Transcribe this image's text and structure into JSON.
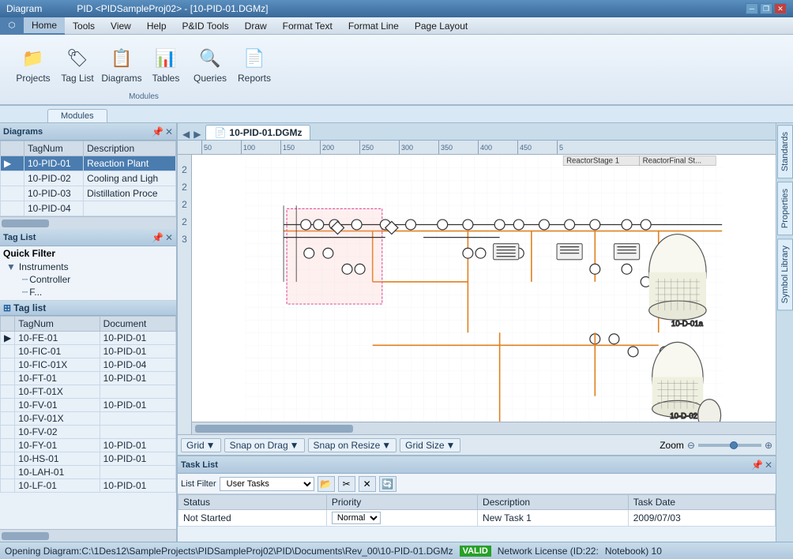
{
  "titleBar": {
    "appTitle": "Diagram",
    "windowTitle": "PID <PIDSampleProj02> - [10-PID-01.DGMz]",
    "minLabel": "─",
    "restoreLabel": "❐",
    "closeLabel": "✕"
  },
  "menuBar": {
    "items": [
      "Home",
      "Tools",
      "View",
      "Help",
      "P&ID Tools",
      "Draw",
      "Format Text",
      "Format Line",
      "Page Layout"
    ]
  },
  "ribbon": {
    "groupLabel": "Modules",
    "buttons": [
      {
        "label": "Projects",
        "icon": "📁"
      },
      {
        "label": "Tag List",
        "icon": "🏷"
      },
      {
        "label": "Diagrams",
        "icon": "📋"
      },
      {
        "label": "Tables",
        "icon": "📊"
      },
      {
        "label": "Queries",
        "icon": "🔍"
      },
      {
        "label": "Reports",
        "icon": "📄"
      }
    ]
  },
  "modulesTab": {
    "label": "Modules"
  },
  "diagrams": {
    "panelTitle": "Diagrams",
    "columns": [
      "TagNum",
      "Description"
    ],
    "rows": [
      {
        "tagNum": "10-PID-01",
        "description": "Reaction Plant",
        "selected": true
      },
      {
        "tagNum": "10-PID-02",
        "description": "Cooling and Ligh"
      },
      {
        "tagNum": "10-PID-03",
        "description": "Distillation Proce"
      },
      {
        "tagNum": "10-PID-04",
        "description": ""
      }
    ]
  },
  "tagList": {
    "panelTitle": "Tag List",
    "quickFilterLabel": "Quick Filter",
    "treeItems": [
      {
        "label": "Instruments",
        "level": 0,
        "expanded": true
      },
      {
        "label": "Controller",
        "level": 1
      }
    ],
    "subPanelLabel": "Tag list",
    "columns": [
      "TagNum",
      "Document"
    ],
    "rows": [
      {
        "tagNum": "10-FE-01",
        "document": "10-PID-01"
      },
      {
        "tagNum": "10-FIC-01",
        "document": "10-PID-01"
      },
      {
        "tagNum": "10-FIC-01X",
        "document": "10-PID-04"
      },
      {
        "tagNum": "10-FT-01",
        "document": "10-PID-01"
      },
      {
        "tagNum": "10-FT-01X",
        "document": ""
      },
      {
        "tagNum": "10-FV-01",
        "document": "10-PID-01"
      },
      {
        "tagNum": "10-FV-01X",
        "document": ""
      },
      {
        "tagNum": "10-FV-02",
        "document": ""
      },
      {
        "tagNum": "10-FY-01",
        "document": "10-PID-01"
      },
      {
        "tagNum": "10-HS-01",
        "document": "10-PID-01"
      },
      {
        "tagNum": "10-LAH-01",
        "document": ""
      },
      {
        "tagNum": "10-LF-01",
        "document": "10-PID-01"
      }
    ]
  },
  "docTab": {
    "name": "10-PID-01.DGMz"
  },
  "rulerTicks": [
    "50",
    "100",
    "150",
    "200",
    "250",
    "300",
    "350",
    "400",
    "450",
    "5"
  ],
  "canvasToolbar": {
    "gridLabel": "Grid",
    "snapDragLabel": "Snap on Drag",
    "snapResizeLabel": "Snap on Resize",
    "gridSizeLabel": "Grid Size",
    "zoomLabel": "Zoom"
  },
  "taskList": {
    "panelTitle": "Task List",
    "filterLabel": "List Filter",
    "filterValue": "User Tasks",
    "tableColumns": [
      "Status",
      "Priority",
      "Description",
      "Task Date"
    ],
    "rows": [
      {
        "status": "Not Started",
        "priority": "Normal",
        "description": "New Task 1",
        "taskDate": "2009/07/03"
      }
    ]
  },
  "rightPanel": {
    "tabs": [
      "Standards",
      "Properties",
      "Symbol Library"
    ]
  },
  "statusBar": {
    "message": "Opening Diagram:C:\\1Des12\\SampleProjects\\PIDSampleProj02\\PID\\Documents\\Rev_00\\10-PID-01.DGMz",
    "validLabel": "VALID",
    "licenseLabel": "Network License (ID:22:",
    "notebookLabel": "Notebook) 10"
  }
}
